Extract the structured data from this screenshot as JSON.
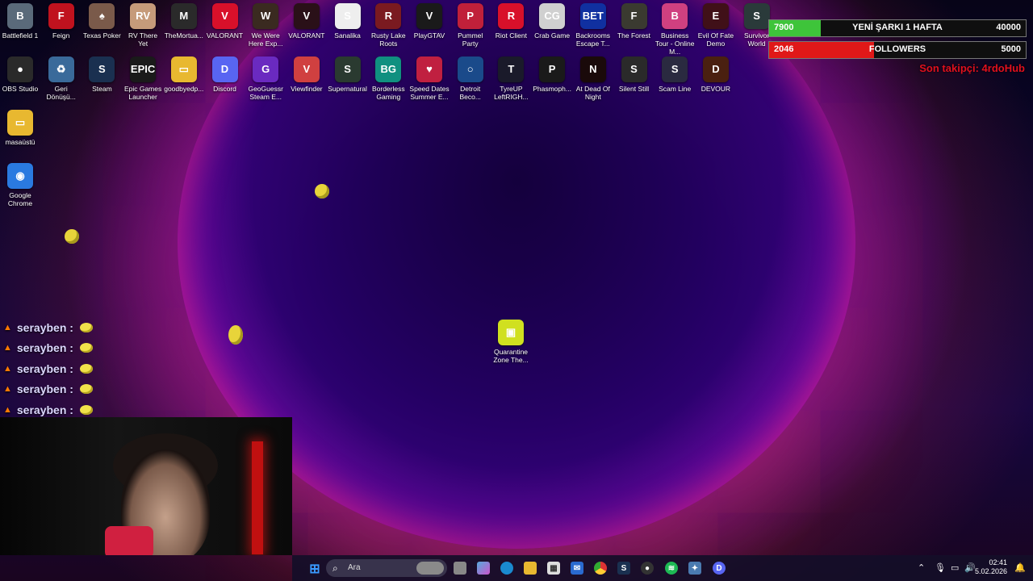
{
  "desktop": {
    "row1": [
      {
        "label": "Battlefield 1",
        "glyph": "B",
        "color": "#5a6a7a"
      },
      {
        "label": "Feign",
        "glyph": "F",
        "color": "#c0121e"
      },
      {
        "label": "Texas Poker",
        "glyph": "♠",
        "color": "#7a5a4a"
      },
      {
        "label": "RV There Yet",
        "glyph": "RV",
        "color": "#c69b7a"
      },
      {
        "label": "TheMortua...",
        "glyph": "M",
        "color": "#2a2a2a"
      },
      {
        "label": "VALORANT",
        "glyph": "V",
        "color": "#d8102a"
      },
      {
        "label": "We Were Here Exp...",
        "glyph": "W",
        "color": "#3a2a20"
      },
      {
        "label": "VALORANT",
        "glyph": "V",
        "color": "#2a1018"
      },
      {
        "label": "Sanalika",
        "glyph": "S",
        "color": "#eeeeee"
      },
      {
        "label": "Rusty Lake Roots",
        "glyph": "R",
        "color": "#7a1a20"
      },
      {
        "label": "PlayGTAV",
        "glyph": "V",
        "color": "#1a1a1a"
      },
      {
        "label": "Pummel Party",
        "glyph": "P",
        "color": "#c0203a"
      },
      {
        "label": "Riot Client",
        "glyph": "R",
        "color": "#d8102a"
      },
      {
        "label": "Crab Game",
        "glyph": "CG",
        "color": "#d0d0d0"
      },
      {
        "label": "Backrooms Escape T...",
        "glyph": "BET",
        "color": "#1030a0"
      },
      {
        "label": "The Forest",
        "glyph": "F",
        "color": "#3a3a30"
      },
      {
        "label": "Business Tour - Online M...",
        "glyph": "B",
        "color": "#d04080"
      },
      {
        "label": "Evil Of Fate Demo",
        "glyph": "E",
        "color": "#401018"
      },
      {
        "label": "Survivor World",
        "glyph": "S",
        "color": "#2a3a3a"
      }
    ],
    "row2": [
      {
        "label": "OBS Studio",
        "glyph": "●",
        "color": "#2a2a2a"
      },
      {
        "label": "Geri Dönüşü...",
        "glyph": "♻",
        "color": "#3a6a9a"
      },
      {
        "label": "Steam",
        "glyph": "S",
        "color": "#1a3050"
      },
      {
        "label": "Epic Games Launcher",
        "glyph": "EPIC",
        "color": "#1a1a1a"
      },
      {
        "label": "goodbyedp...",
        "glyph": "▭",
        "color": "#e8b830"
      },
      {
        "label": "Discord",
        "glyph": "D",
        "color": "#5865f2"
      },
      {
        "label": "GeoGuessr Steam E...",
        "glyph": "G",
        "color": "#6a2ac0"
      },
      {
        "label": "Viewfinder",
        "glyph": "V",
        "color": "#d04040"
      },
      {
        "label": "Supernatural",
        "glyph": "S",
        "color": "#2a3a30"
      },
      {
        "label": "Borderless Gaming",
        "glyph": "BG",
        "color": "#109080"
      },
      {
        "label": "Speed Dates Summer E...",
        "glyph": "♥",
        "color": "#c02040"
      },
      {
        "label": "Detroit Beco...",
        "glyph": "○",
        "color": "#1a4a8a"
      },
      {
        "label": "TyreUP LeftRIGH...",
        "glyph": "T",
        "color": "#1a1a2a"
      },
      {
        "label": "Phasmoph...",
        "glyph": "P",
        "color": "#1a1a1a"
      },
      {
        "label": "At Dead Of Night",
        "glyph": "N",
        "color": "#1a0a0a"
      },
      {
        "label": "Silent Still",
        "glyph": "S",
        "color": "#2a2a2a"
      },
      {
        "label": "Scam Line",
        "glyph": "S",
        "color": "#2a2a40"
      },
      {
        "label": "DEVOUR",
        "glyph": "D",
        "color": "#4a2010"
      }
    ],
    "col": [
      {
        "label": "masaüstü",
        "glyph": "▭",
        "color": "#e8b830"
      },
      {
        "label": "Google Chrome",
        "glyph": "◉",
        "color": "#2a7ae0"
      }
    ],
    "center_icon": {
      "label": "Quarantine Zone The...",
      "glyph": "▣",
      "color": "#d0e020"
    }
  },
  "overlay": {
    "goal1": {
      "left": "7900",
      "center": "YENİ ŞARKI 1 HAFTA",
      "right": "40000",
      "color": "#3ec43a",
      "progress": 0.2
    },
    "goal2": {
      "left": "2046",
      "center": "FOLLOWERS",
      "right": "5000",
      "color": "#e01818",
      "progress": 0.41
    },
    "last_follower": "Son takipçi: 4rdoHub"
  },
  "chat": [
    {
      "user": "serayben :"
    },
    {
      "user": "serayben :"
    },
    {
      "user": "serayben :"
    },
    {
      "user": "serayben :"
    },
    {
      "user": "serayben :"
    }
  ],
  "taskbar": {
    "search_placeholder": "Ara",
    "time": "02:41",
    "date": "5.02.2026"
  }
}
